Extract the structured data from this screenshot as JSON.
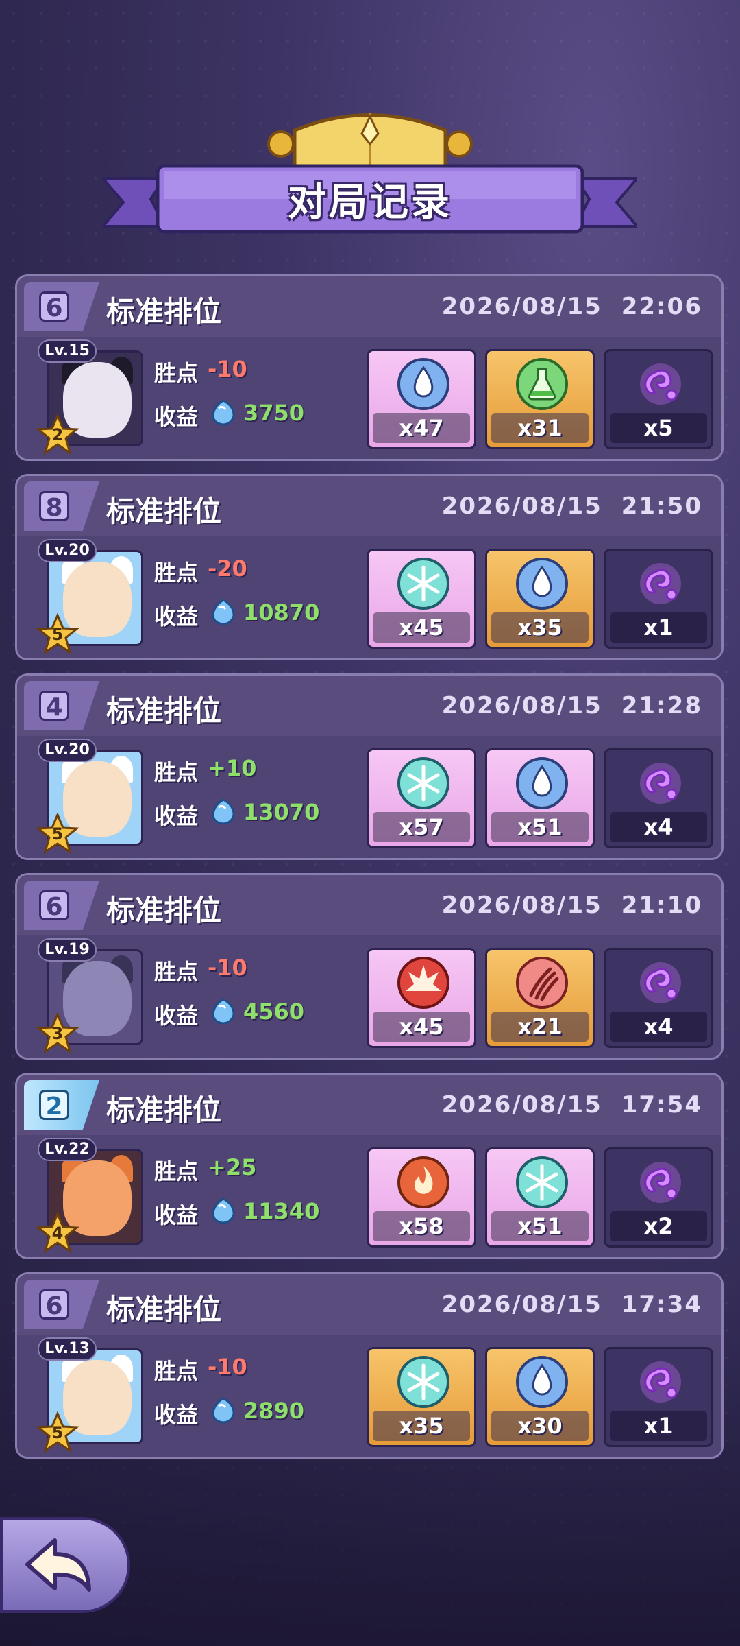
{
  "title": "对局记录",
  "records": [
    {
      "rank": "6",
      "mode": "标准排位",
      "date": "2026/08/15",
      "time": "22:06",
      "level": "Lv.15",
      "stars": "2",
      "points_label": "胜点",
      "points": "-10",
      "points_sign": "neg",
      "income_label": "收益",
      "income": "3750",
      "avatar_icon": "dark-horned-girl-avatar",
      "items": [
        {
          "icon": "water-drop-icon",
          "count": "x47",
          "style": "pink"
        },
        {
          "icon": "potion-flask-icon",
          "count": "x31",
          "style": "gold"
        },
        {
          "icon": "purple-spirit-icon",
          "count": "x5",
          "style": "dark"
        }
      ]
    },
    {
      "rank": "8",
      "mode": "标准排位",
      "date": "2026/08/15",
      "time": "21:50",
      "level": "Lv.20",
      "stars": "5",
      "points_label": "胜点",
      "points": "-20",
      "points_sign": "neg",
      "income_label": "收益",
      "income": "10870",
      "avatar_icon": "white-hood-girl-avatar",
      "items": [
        {
          "icon": "snowflake-icon",
          "count": "x45",
          "style": "pink"
        },
        {
          "icon": "water-drop-icon",
          "count": "x35",
          "style": "gold"
        },
        {
          "icon": "purple-spirit-icon",
          "count": "x1",
          "style": "dark"
        }
      ]
    },
    {
      "rank": "4",
      "mode": "标准排位",
      "date": "2026/08/15",
      "time": "21:28",
      "level": "Lv.20",
      "stars": "5",
      "points_label": "胜点",
      "points": "+10",
      "points_sign": "pos",
      "income_label": "收益",
      "income": "13070",
      "avatar_icon": "white-hood-girl-avatar",
      "items": [
        {
          "icon": "snowflake-icon",
          "count": "x57",
          "style": "pink"
        },
        {
          "icon": "water-drop-icon",
          "count": "x51",
          "style": "pink"
        },
        {
          "icon": "purple-spirit-icon",
          "count": "x4",
          "style": "dark"
        }
      ]
    },
    {
      "rank": "6",
      "mode": "标准排位",
      "date": "2026/08/15",
      "time": "21:10",
      "level": "Lv.19",
      "stars": "3",
      "points_label": "胜点",
      "points": "-10",
      "points_sign": "neg",
      "income_label": "收益",
      "income": "4560",
      "avatar_icon": "armored-bird-avatar",
      "items": [
        {
          "icon": "fire-burst-icon",
          "count": "x45",
          "style": "pink"
        },
        {
          "icon": "claw-slash-icon",
          "count": "x21",
          "style": "gold"
        },
        {
          "icon": "purple-spirit-icon",
          "count": "x4",
          "style": "dark"
        }
      ]
    },
    {
      "rank": "2",
      "mode": "标准排位",
      "date": "2026/08/15",
      "time": "17:54",
      "level": "Lv.22",
      "stars": "4",
      "points_label": "胜点",
      "points": "+25",
      "points_sign": "pos",
      "income_label": "收益",
      "income": "11340",
      "avatar_icon": "fire-fox-avatar",
      "items": [
        {
          "icon": "flame-icon",
          "count": "x58",
          "style": "pink"
        },
        {
          "icon": "snowflake-icon",
          "count": "x51",
          "style": "pink"
        },
        {
          "icon": "purple-spirit-icon",
          "count": "x2",
          "style": "dark"
        }
      ]
    },
    {
      "rank": "6",
      "mode": "标准排位",
      "date": "2026/08/15",
      "time": "17:34",
      "level": "Lv.13",
      "stars": "5",
      "points_label": "胜点",
      "points": "-10",
      "points_sign": "neg",
      "income_label": "收益",
      "income": "2890",
      "avatar_icon": "white-hood-girl-avatar",
      "items": [
        {
          "icon": "snowflake-icon",
          "count": "x35",
          "style": "gold"
        },
        {
          "icon": "water-drop-icon",
          "count": "x30",
          "style": "gold"
        },
        {
          "icon": "purple-spirit-icon",
          "count": "x1",
          "style": "dark"
        }
      ]
    }
  ],
  "colors": {
    "negative": "#ff7a6a",
    "positive": "#8fe06a",
    "card_bg": "#4f4473",
    "header_bg": "#5a4d7e"
  }
}
